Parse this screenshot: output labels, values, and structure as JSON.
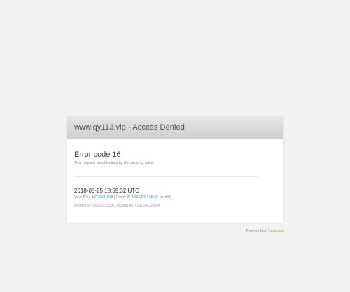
{
  "card": {
    "title": "www.qy113.vip - Access Denied",
    "error_code": "Error code 16",
    "error_description": "This request was blocked by the security rules",
    "timestamp": "2018-05-25 18:59:32 UTC",
    "ip_prefix": "Your IP is",
    "your_ip": "137.108.198",
    "proxy_label": "| Proxy IP",
    "proxy_ip": "103.254.165.36",
    "proxy_suffix": "(icn99)",
    "incident_id": "Incident ID: 960001930001751508-8674151606323564"
  },
  "footer": {
    "powered_prefix": "Powered by",
    "brand": "Incapsula"
  },
  "colors": {
    "background": "#f2f2f2",
    "accent": "#3aa0c8",
    "brand": "#8cc63f"
  }
}
